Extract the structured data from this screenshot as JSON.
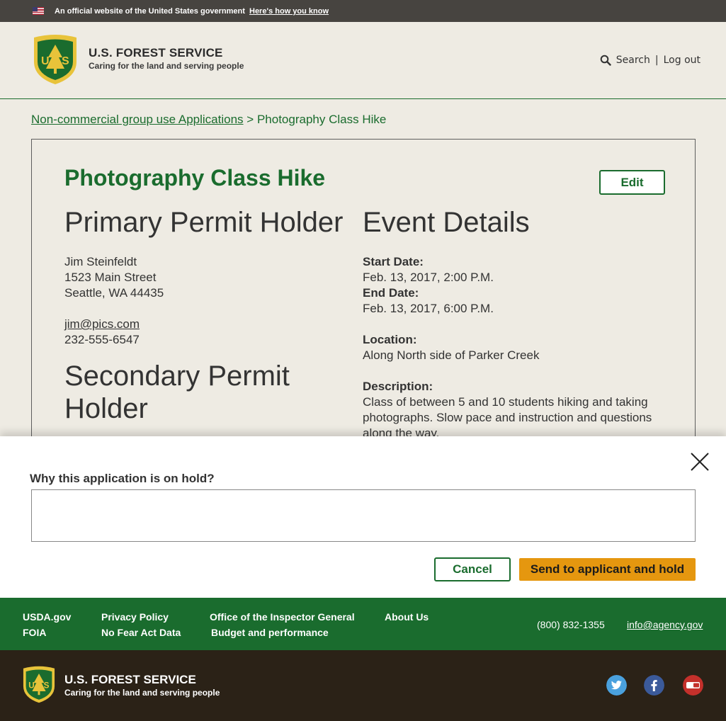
{
  "gov_banner": {
    "text": "An official website of the United States government",
    "link": "Here's how you know"
  },
  "header": {
    "title": "U.S. FOREST SERVICE",
    "tagline": "Caring for the land and serving people",
    "search_label": "Search",
    "separator": "|",
    "logout_label": "Log out"
  },
  "breadcrumb": {
    "parent": "Non-commercial group use Applications",
    "separator": ">",
    "current": "Photography Class Hike"
  },
  "card": {
    "title": "Photography Class Hike",
    "edit_label": "Edit",
    "primary": {
      "heading": "Primary Permit Holder",
      "name": "Jim Steinfeldt",
      "street": "1523 Main Street",
      "city": "Seattle, WA 44435",
      "email": "jim@pics.com",
      "phone": "232-555-6547"
    },
    "secondary": {
      "heading": "Secondary Permit Holder"
    },
    "event": {
      "heading": "Event Details",
      "start_label": "Start Date:",
      "start_value": "Feb. 13, 2017, 2:00 P.M.",
      "end_label": "End Date:",
      "end_value": "Feb. 13, 2017, 6:00 P.M.",
      "location_label": "Location:",
      "location_value": "Along North side of Parker Creek",
      "description_label": "Description:",
      "description_value": "Class of between 5 and 10 students hiking and taking photographs. Slow pace and instruction and questions along the way."
    }
  },
  "modal": {
    "label": "Why this application is on hold?",
    "input_value": "",
    "cancel_label": "Cancel",
    "send_label": "Send to applicant and hold"
  },
  "footer": {
    "links": {
      "usda": "USDA.gov",
      "foia": "FOIA",
      "privacy": "Privacy Policy",
      "nofear": "No Fear Act Data",
      "inspector": "Office of the Inspector General",
      "budget": "Budget and performance",
      "about": "About Us"
    },
    "phone": "(800) 832-1355",
    "email": "info@agency.gov",
    "title": "U.S. FOREST SERVICE",
    "tagline": "Caring for the land and serving people",
    "social": [
      "twitter-icon",
      "facebook-icon",
      "youtube-icon"
    ]
  },
  "colors": {
    "brand_green": "#1a6c2e",
    "accent_orange": "#e5970f",
    "background": "#eeebe3",
    "banner": "#474440",
    "footer_dark": "#2b2217"
  }
}
